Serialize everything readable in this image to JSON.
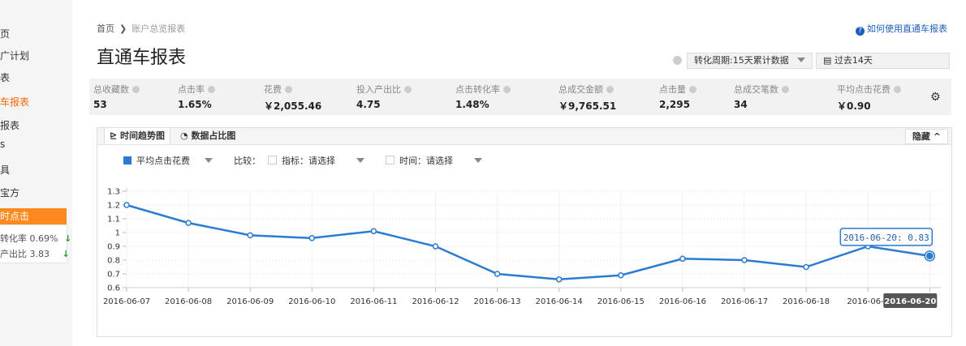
{
  "sidebar": {
    "items": [
      {
        "label": "页"
      },
      {
        "label": "广计划"
      },
      {
        "label": "表"
      },
      {
        "label": "车报表"
      },
      {
        "label": "报表"
      },
      {
        "label": "s"
      },
      {
        "label": "具"
      },
      {
        "label": "宝方"
      }
    ],
    "highlight": "时点击",
    "metrics": [
      {
        "label": "转化率 0.69%",
        "arrow": "↓"
      },
      {
        "label": "产出比 3.83",
        "arrow": "↓"
      }
    ]
  },
  "breadcrumb": {
    "home": "首页",
    "separator": "❯",
    "current": "账户总览报表"
  },
  "help_link": "如何使用直通车报表",
  "page_title": "直通车报表",
  "filters": {
    "conversion_period": "转化周期:15天累计数据",
    "date_range": "过去14天"
  },
  "metrics": [
    {
      "label": "总收藏数",
      "value": "53"
    },
    {
      "label": "点击率",
      "value": "1.65%"
    },
    {
      "label": "花费",
      "value": "￥2,055.46"
    },
    {
      "label": "投入产出比",
      "value": "4.75"
    },
    {
      "label": "点击转化率",
      "value": "1.48%"
    },
    {
      "label": "总成交金额",
      "value": "￥9,765.51"
    },
    {
      "label": "点击量",
      "value": "2,295"
    },
    {
      "label": "总成交笔数",
      "value": "34"
    },
    {
      "label": "平均点击花费",
      "value": "￥0.90"
    }
  ],
  "tabs": [
    {
      "label": "时间趋势图"
    },
    {
      "label": "数据占比图"
    }
  ],
  "hide_button": "隐藏",
  "controls": {
    "metric_select": "平均点击花费",
    "compare_label": "比较：",
    "indicator_select": "指标：请选择",
    "time_select": "时间：请选择"
  },
  "colors": {
    "accent": "#f60",
    "line": "#2b7bd2"
  },
  "chart_data": {
    "type": "line",
    "x": [
      "2016-06-07",
      "2016-06-08",
      "2016-06-09",
      "2016-06-10",
      "2016-06-11",
      "2016-06-12",
      "2016-06-13",
      "2016-06-14",
      "2016-06-15",
      "2016-06-16",
      "2016-06-17",
      "2016-06-18",
      "2016-06-19",
      "2016-06-20"
    ],
    "x_tick_labels": [
      "2016-06-07",
      "2016-06-08",
      "2016-06-09",
      "2016-06-10",
      "2016-06-11",
      "2016-06-12",
      "2016-06-13",
      "2016-06-14",
      "2016-06-15",
      "2016-06-16",
      "2016-06-17",
      "2016-06-18",
      "2016-06-1"
    ],
    "series": [
      {
        "name": "平均点击花费",
        "values": [
          1.2,
          1.07,
          0.98,
          0.96,
          1.01,
          0.9,
          0.7,
          0.66,
          0.69,
          0.81,
          0.8,
          0.75,
          0.9,
          0.83
        ]
      }
    ],
    "ylim": [
      0.6,
      1.3
    ],
    "yticks": [
      0.6,
      0.7,
      0.8,
      0.9,
      1,
      1.1,
      1.2,
      1.3
    ],
    "grid": true,
    "tooltip": "2016-06-20: 0.83",
    "hover_x_label": "2016-06-20"
  }
}
